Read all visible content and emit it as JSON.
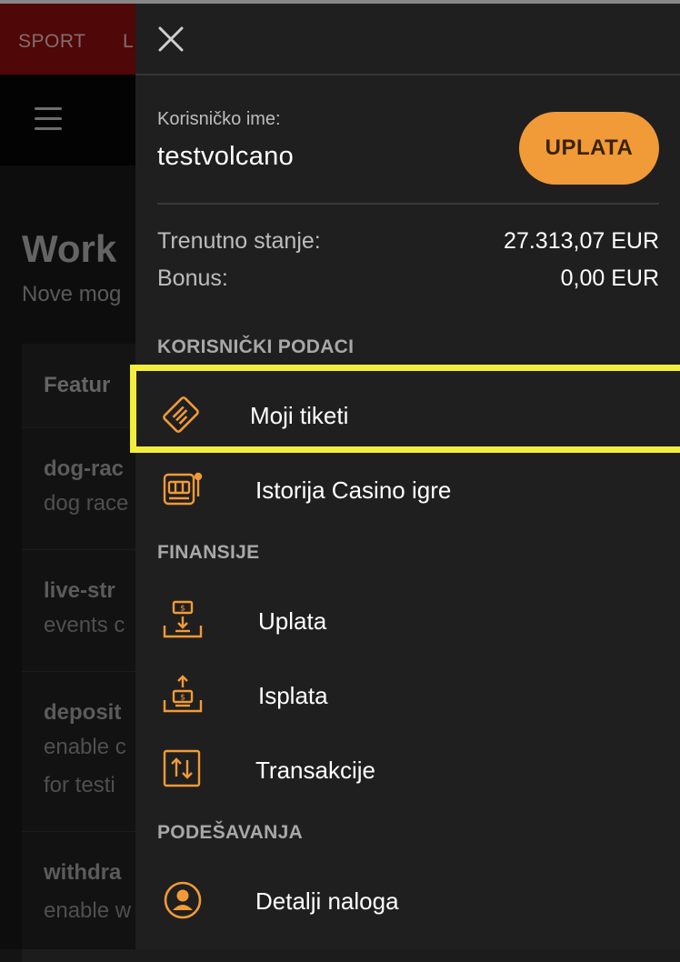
{
  "background_page": {
    "top_tabs": [
      "SPORT",
      "L"
    ],
    "title": "Work",
    "subtitle": "Nove mog",
    "table_header": "Featur",
    "rows": [
      {
        "key": "dog-rac",
        "value": "dog race"
      },
      {
        "key": "live-str",
        "value": "events c"
      },
      {
        "key": "deposit",
        "value": "enable c",
        "value2": "for testi"
      },
      {
        "key": "withdra",
        "value": "enable w"
      }
    ]
  },
  "drawer": {
    "username_label": "Korisničko ime:",
    "username": "testvolcano",
    "deposit_button": "UPLATA",
    "balance_label": "Trenutno stanje:",
    "balance_value": "27.313,07 EUR",
    "bonus_label": "Bonus:",
    "bonus_value": "0,00 EUR",
    "sections": {
      "user_data": "KORISNIČKI PODACI",
      "finances": "FINANSIJE",
      "settings": "PODEŠAVANJA"
    },
    "items": {
      "my_tickets": "Moji tiketi",
      "casino_history": "Istorija Casino igre",
      "deposit": "Uplata",
      "withdrawal": "Isplata",
      "transactions": "Transakcije",
      "account_details": "Detalji naloga"
    },
    "icons": {
      "my_tickets": "ticket-icon",
      "casino_history": "slot-machine-icon",
      "deposit": "deposit-tray-icon",
      "withdrawal": "withdraw-tray-icon",
      "transactions": "swap-arrows-icon",
      "account_details": "user-circle-icon"
    },
    "accent_color": "#f19a38",
    "highlight_color": "#f3ee3b"
  }
}
